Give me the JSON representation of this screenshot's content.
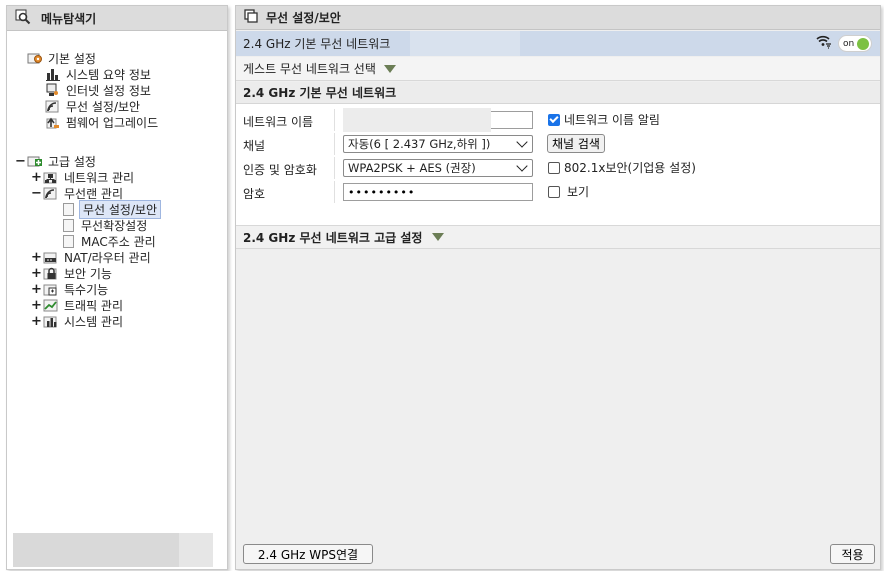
{
  "left": {
    "title": "메뉴탐색기",
    "basic_settings": {
      "label": "기본 설정",
      "children": [
        "시스템 요약 정보",
        "인터넷 설정 정보",
        "무선 설정/보안",
        "펌웨어 업그레이드"
      ]
    },
    "advanced_settings": {
      "label": "고급 설정",
      "toggle": "−",
      "items": [
        {
          "toggle": "+",
          "label": "네트워크 관리"
        },
        {
          "toggle": "−",
          "label": "무선랜 관리",
          "children": [
            "무선 설정/보안",
            "무선확장설정",
            "MAC주소 관리"
          ]
        },
        {
          "toggle": "+",
          "label": "NAT/라우터 관리"
        },
        {
          "toggle": "+",
          "label": "보안 기능"
        },
        {
          "toggle": "+",
          "label": "특수기능"
        },
        {
          "toggle": "+",
          "label": "트래픽 관리"
        },
        {
          "toggle": "+",
          "label": "시스템 관리"
        }
      ]
    }
  },
  "right": {
    "title": "무선 설정/보안",
    "basic_bar": {
      "label": "2.4 GHz 기본 무선 네트워크",
      "toggle_label": "on"
    },
    "guest_bar": {
      "label": "게스트 무선 네트워크 선택"
    },
    "form": {
      "section_title": "2.4 GHz 기본 무선 네트워크",
      "ssid": {
        "label": "네트워크 이름",
        "value": "",
        "broadcast_label": "네트워크 이름 알림",
        "broadcast_checked": true
      },
      "channel": {
        "label": "채널",
        "selected": "자동(6 [ 2.437 GHz,하위 ])",
        "scan_label": "채널 검색"
      },
      "auth": {
        "label": "인증 및 암호화",
        "selected": "WPA2PSK + AES (권장)",
        "enterprise_label": "802.1x보안(기업용 설정)",
        "enterprise_checked": false
      },
      "password": {
        "label": "암호",
        "value": "•••••••••",
        "show_label": "보기",
        "show_checked": false
      }
    },
    "advanced_bar": {
      "label": "2.4 GHz 무선 네트워크 고급 설정"
    },
    "buttons": {
      "wps": "2.4 GHz WPS연결",
      "apply": "적용"
    }
  },
  "colors": {
    "selected_bg": "#dde6f7",
    "basic_bar_bg": "#cdd9ea",
    "toggle_on": "#7cc142",
    "check_on": "#1a73e8",
    "arrow": "#6b7d55"
  }
}
